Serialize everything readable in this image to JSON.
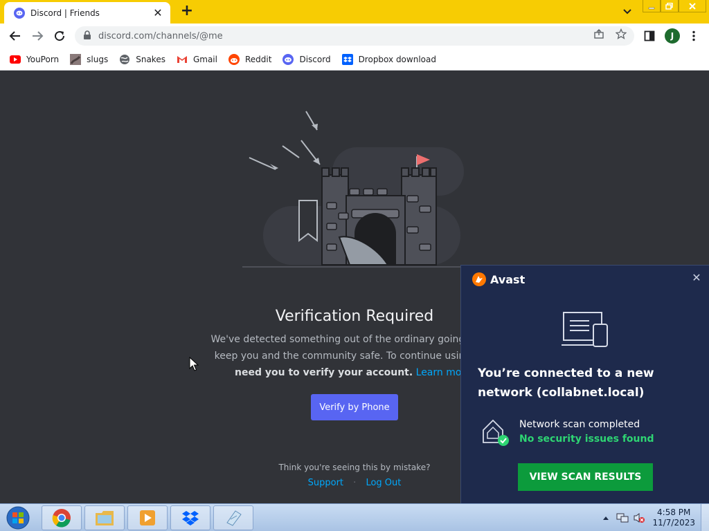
{
  "browser": {
    "tab": {
      "title": "Discord | Friends"
    },
    "address_bar": {
      "url": "discord.com/channels/@me"
    },
    "profile_initial": "J",
    "bookmarks": [
      {
        "label": "YouPorn",
        "icon": "youtube-style-icon"
      },
      {
        "label": "slugs",
        "icon": "image-icon"
      },
      {
        "label": "Snakes",
        "icon": "globe-icon"
      },
      {
        "label": "Gmail",
        "icon": "gmail-icon"
      },
      {
        "label": "Reddit",
        "icon": "reddit-icon"
      },
      {
        "label": "Discord",
        "icon": "discord-icon"
      },
      {
        "label": "Dropbox download",
        "icon": "dropbox-icon"
      }
    ]
  },
  "page": {
    "title": "Verification Required",
    "body_line1": "We've detected something out of the ordinary going on, an",
    "body_line2": "keep you and the community safe. To continue using Disc",
    "body_bold": "need you to verify your account.",
    "learn_more": "Learn more.",
    "verify_button": "Verify by Phone",
    "mistake_text": "Think you're seeing this by mistake?",
    "support_link": "Support",
    "separator": "·",
    "logout_link": "Log Out"
  },
  "avast": {
    "brand": "Avast",
    "headline": "You’re connected to a new network (collabnet.local)",
    "scan_status": "Network scan completed",
    "scan_result": "No security issues found",
    "button": "VIEW SCAN RESULTS"
  },
  "taskbar": {
    "time": "4:58 PM",
    "date": "11/7/2023"
  },
  "colors": {
    "tabbar": "#f7cc03",
    "discord_bg": "#313338",
    "blurple": "#5865f2",
    "link": "#00a8fc",
    "avast_bg": "#1e2a4c",
    "avast_green": "#0c9b3c"
  }
}
